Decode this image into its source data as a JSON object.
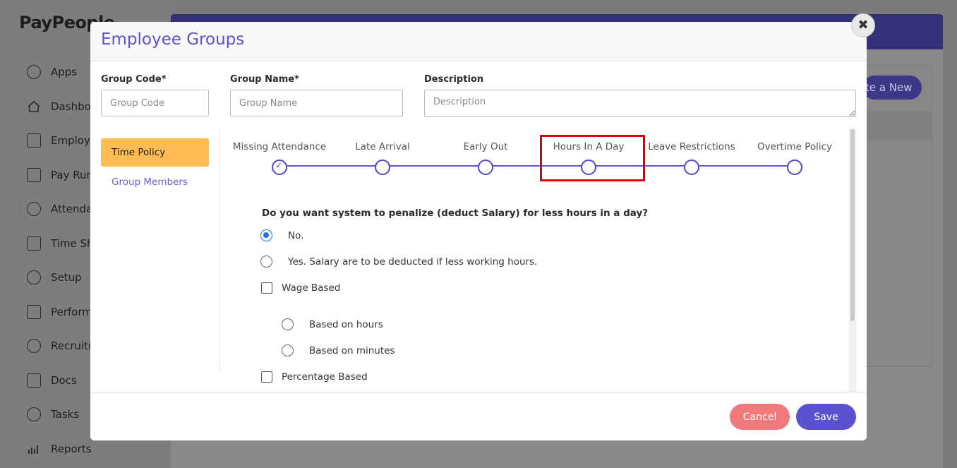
{
  "app": {
    "logo": "PayPeople"
  },
  "sidebar": {
    "items": [
      {
        "label": "Apps",
        "icon": "clock-icon"
      },
      {
        "label": "Dashbo",
        "icon": "home-icon"
      },
      {
        "label": "Employ",
        "icon": "id-card-icon"
      },
      {
        "label": "Pay Run",
        "icon": "credit-card-icon"
      },
      {
        "label": "Attenda",
        "icon": "clock-icon"
      },
      {
        "label": "Time Sh",
        "icon": "sheet-icon"
      },
      {
        "label": "Setup",
        "icon": "gear-icon"
      },
      {
        "label": "Perform",
        "icon": "chart-icon"
      },
      {
        "label": "Recruitm",
        "icon": "people-icon"
      },
      {
        "label": "Docs",
        "icon": "docs-icon"
      },
      {
        "label": "Tasks",
        "icon": "check-circle-icon"
      },
      {
        "label": "Reports",
        "icon": "bar-chart-icon"
      }
    ]
  },
  "background": {
    "create_button": "te a New"
  },
  "modal": {
    "title": "Employee Groups",
    "close_symbol": "✖",
    "fields": {
      "group_code": {
        "label": "Group Code*",
        "placeholder": "Group Code",
        "value": ""
      },
      "group_name": {
        "label": "Group Name*",
        "placeholder": "Group Name",
        "value": ""
      },
      "description": {
        "label": "Description",
        "placeholder": "Description",
        "value": ""
      }
    },
    "tabs": [
      {
        "label": "Time Policy",
        "active": true
      },
      {
        "label": "Group Members",
        "active": false
      }
    ],
    "stepper": {
      "steps": [
        {
          "label": "Missing Attendance",
          "completed": true
        },
        {
          "label": "Late Arrival",
          "completed": false
        },
        {
          "label": "Early Out",
          "completed": false
        },
        {
          "label": "Hours In A Day",
          "completed": false,
          "highlighted": true
        },
        {
          "label": "Leave Restrictions",
          "completed": false
        },
        {
          "label": "Overtime Policy",
          "completed": false
        }
      ]
    },
    "question": "Do you want system to penalize (deduct Salary) for less hours in a day?",
    "options": {
      "no": {
        "label": "No.",
        "selected": true
      },
      "yes": {
        "label": "Yes. Salary are to be deducted if less working hours.",
        "selected": false
      },
      "wage_based": {
        "label": "Wage Based",
        "checked": false
      },
      "based_on_hours": {
        "label": "Based on hours",
        "selected": false
      },
      "based_on_minutes": {
        "label": "Based on minutes",
        "selected": false
      },
      "percentage_based": {
        "label": "Percentage Based",
        "checked": false
      }
    },
    "footer": {
      "cancel_label": "Cancel",
      "save_label": "Save"
    }
  },
  "colors": {
    "accent": "#5b52cf",
    "active_tab": "#fdbb52",
    "cancel": "#f07a7a",
    "radio_on": "#1a73e8",
    "highlight": "#e00000"
  }
}
